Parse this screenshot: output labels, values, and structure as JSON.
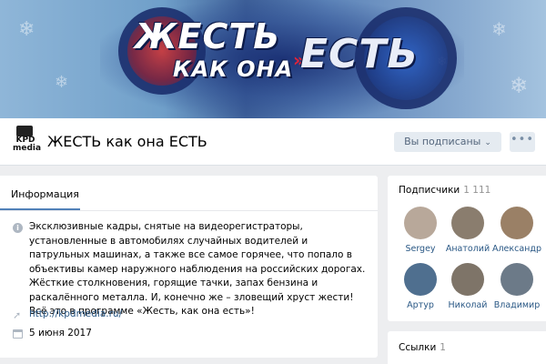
{
  "cover": {
    "logo_line1": "ЖЕСТЬ",
    "logo_line2": "КАК ОНА",
    "logo_line3": "ЕСТЬ"
  },
  "header": {
    "avatar_label": "KPD media",
    "title": "ЖЕСТЬ как она ЕСТЬ",
    "subscribed_label": "Вы подписаны",
    "more_label": "•••"
  },
  "info": {
    "tab_label": "Информация",
    "description": "Эксклюзивные кадры, снятые на видеорегистраторы, установленные в автомобилях случайных водителей и патрульных машинах, а также все самое горячее, что попало в объективы камер наружного наблюдения на российских дорогах. Жёсткие столкновения, горящие тачки, запах бензина и раскалённого металла. И, конечно же – зловещий хруст жести! Всё это в программе «Жесть, как она есть»!",
    "link": "http://kpdmedia.ru/",
    "date": "5 июня 2017"
  },
  "subscribers": {
    "title": "Подписчики",
    "count": "1 111",
    "people": [
      {
        "name": "Sergey",
        "color": "#b8a89a"
      },
      {
        "name": "Анатолий",
        "color": "#8a7d6e"
      },
      {
        "name": "Александр",
        "color": "#9a8066"
      },
      {
        "name": "Артур",
        "color": "#4f6f8f"
      },
      {
        "name": "Николай",
        "color": "#7e7468"
      },
      {
        "name": "Владимир",
        "color": "#6c7a88"
      }
    ]
  },
  "links": {
    "title": "Ссылки",
    "count": "1"
  },
  "colors": {
    "accent": "#5181b8",
    "link": "#2a5885",
    "background": "#edeef0"
  }
}
